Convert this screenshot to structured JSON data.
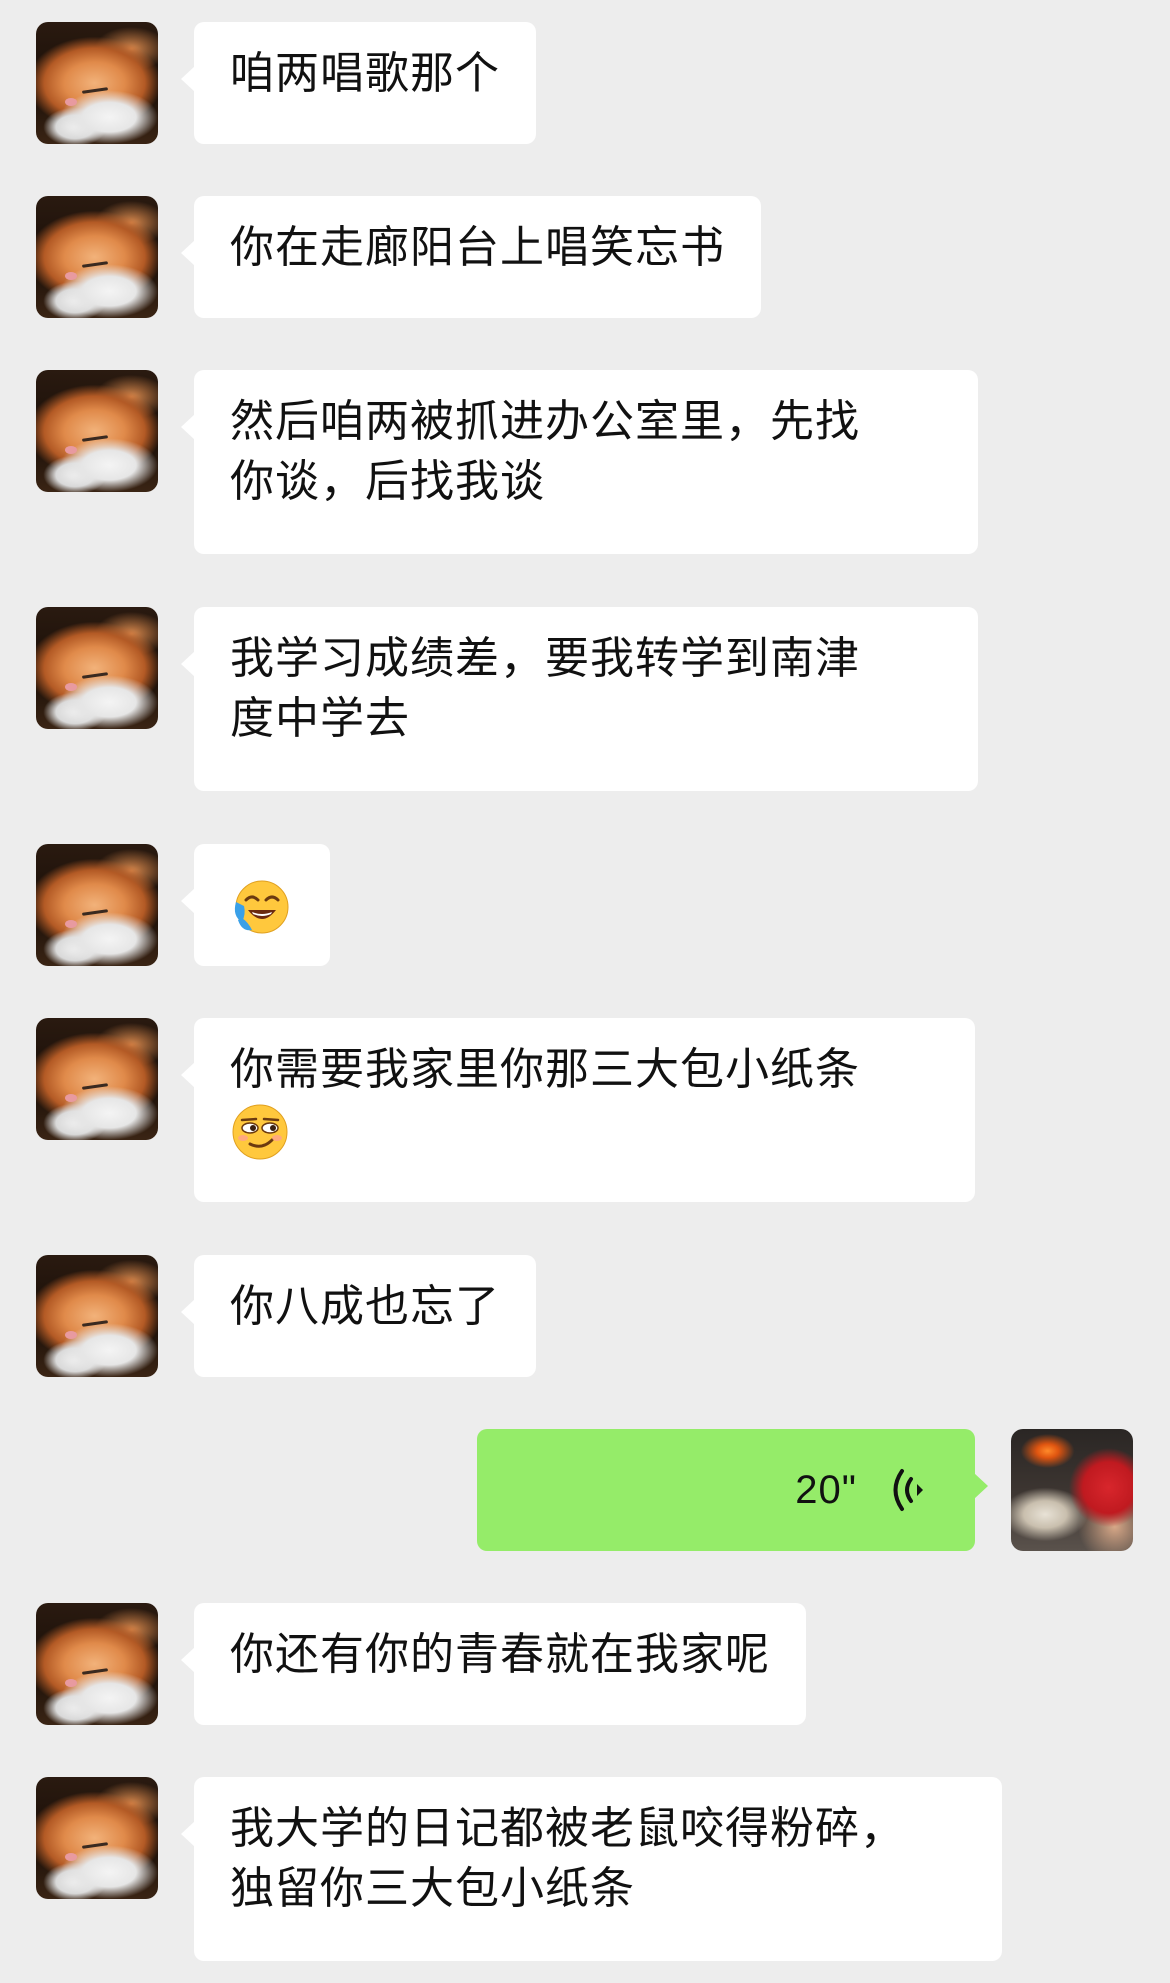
{
  "messages": [
    {
      "id": 1,
      "side": "left",
      "text": "咱两唱歌那个"
    },
    {
      "id": 2,
      "side": "left",
      "text": "你在走廊阳台上唱笑忘书"
    },
    {
      "id": 3,
      "side": "left",
      "line1": "然后咱两被抓进办公室里，先找",
      "line2": "你谈，后找我谈"
    },
    {
      "id": 4,
      "side": "left",
      "line1": "我学习成绩差，要我转学到南津",
      "line2": "度中学去"
    },
    {
      "id": 5,
      "side": "left",
      "emoji": "laugh-cry-emoji"
    },
    {
      "id": 6,
      "side": "left",
      "line1": "你需要我家里你那三大包小纸条",
      "emoji": "smirk-emoji"
    },
    {
      "id": 7,
      "side": "left",
      "text": "你八成也忘了"
    },
    {
      "id": 8,
      "side": "right",
      "type": "voice",
      "duration": "20\""
    },
    {
      "id": 9,
      "side": "left",
      "text": "你还有你的青春就在我家呢"
    },
    {
      "id": 10,
      "side": "left",
      "line1": "我大学的日记都被老鼠咬得粉碎，",
      "line2": "独留你三大包小纸条"
    }
  ],
  "colors": {
    "background": "#ededed",
    "incoming_bubble": "#ffffff",
    "outgoing_bubble": "#95ec69"
  }
}
